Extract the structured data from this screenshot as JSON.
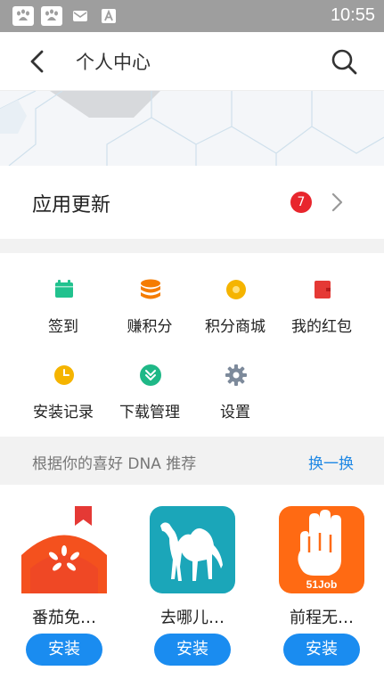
{
  "status_bar": {
    "time": "10:55",
    "icons": [
      "baidu-icon",
      "baidu-icon",
      "mail-icon",
      "font-a-icon"
    ]
  },
  "header": {
    "title": "个人中心"
  },
  "update": {
    "label": "应用更新",
    "badge_count": "7"
  },
  "menu": [
    {
      "label": "签到",
      "icon": "calendar-icon",
      "color": "#21c28e"
    },
    {
      "label": "赚积分",
      "icon": "coins-icon",
      "color": "#f57c00"
    },
    {
      "label": "积分商城",
      "icon": "coin-icon",
      "color": "#f5b400"
    },
    {
      "label": "我的红包",
      "icon": "red-envelope-icon",
      "color": "#e53935"
    },
    {
      "label": "安装记录",
      "icon": "clock-icon",
      "color": "#f5b400"
    },
    {
      "label": "下载管理",
      "icon": "download-icon",
      "color": "#1fb887"
    },
    {
      "label": "设置",
      "icon": "gear-icon",
      "color": "#7d8a9b"
    }
  ],
  "recommend": {
    "title": "根据你的喜好 DNA 推荐",
    "switch_label": "换一换",
    "apps": [
      {
        "name": "番茄免…",
        "install_label": "安装"
      },
      {
        "name": "去哪儿…",
        "install_label": "安装"
      },
      {
        "name": "前程无…",
        "install_label": "安装",
        "icon_text": "51Job"
      }
    ]
  },
  "colors": {
    "accent": "#1a8cf0",
    "badge": "#e8262d",
    "status_bar": "#9e9e9e"
  }
}
